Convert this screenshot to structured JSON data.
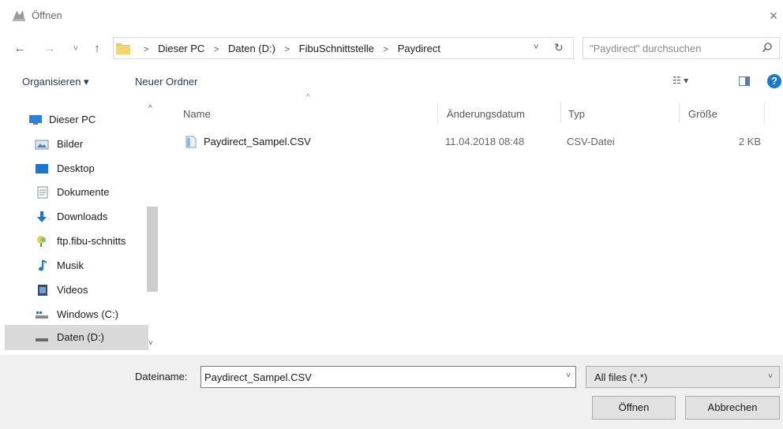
{
  "window": {
    "title": "Öffnen",
    "close_label": "×"
  },
  "nav": {
    "back": "←",
    "forward": "→",
    "recent": "˅",
    "up": "↑",
    "breadcrumb": [
      "Dieser PC",
      "Daten (D:)",
      "FibuSchnittstelle",
      "Paydirect"
    ],
    "separator": ">",
    "dropdown": "˅",
    "refresh": "↻",
    "search_placeholder": "\"Paydirect\" durchsuchen"
  },
  "toolbar": {
    "organize_label": "Organisieren ▾",
    "new_folder_label": "Neuer Ordner",
    "view_label": "☷ ▾",
    "help_label": "?"
  },
  "sidebar": {
    "items": [
      {
        "label": "Dieser PC",
        "icon": "pc-icon"
      },
      {
        "label": "Bilder",
        "icon": "pictures-icon"
      },
      {
        "label": "Desktop",
        "icon": "desktop-icon"
      },
      {
        "label": "Dokumente",
        "icon": "documents-icon"
      },
      {
        "label": "Downloads",
        "icon": "downloads-icon"
      },
      {
        "label": "ftp.fibu-schnitts",
        "icon": "network-icon"
      },
      {
        "label": "Musik",
        "icon": "music-icon"
      },
      {
        "label": "Videos",
        "icon": "videos-icon"
      },
      {
        "label": "Windows (C:)",
        "icon": "drive-icon"
      },
      {
        "label": "Daten (D:)",
        "icon": "drive-icon"
      }
    ],
    "scroll_up": "^",
    "scroll_down": "˅"
  },
  "filelist": {
    "columns": [
      "Name",
      "Änderungsdatum",
      "Typ",
      "Größe"
    ],
    "sort_indicator": "^",
    "rows": [
      {
        "name": "Paydirect_Sampel.CSV",
        "date": "11.04.2018 08:48",
        "type": "CSV-Datei",
        "size": "2 KB"
      }
    ]
  },
  "footer": {
    "filename_label": "Dateiname:",
    "filename_value": "Paydirect_Sampel.CSV",
    "filename_dropdown": "˅",
    "filetype_value": "All files (*.*)",
    "filetype_chevron": "˅",
    "open_label": "Öffnen",
    "cancel_label": "Abbrechen"
  },
  "colors": {
    "accent": "#1979ca",
    "selection": "#d9d9d9",
    "folder": "#f3c84b"
  }
}
